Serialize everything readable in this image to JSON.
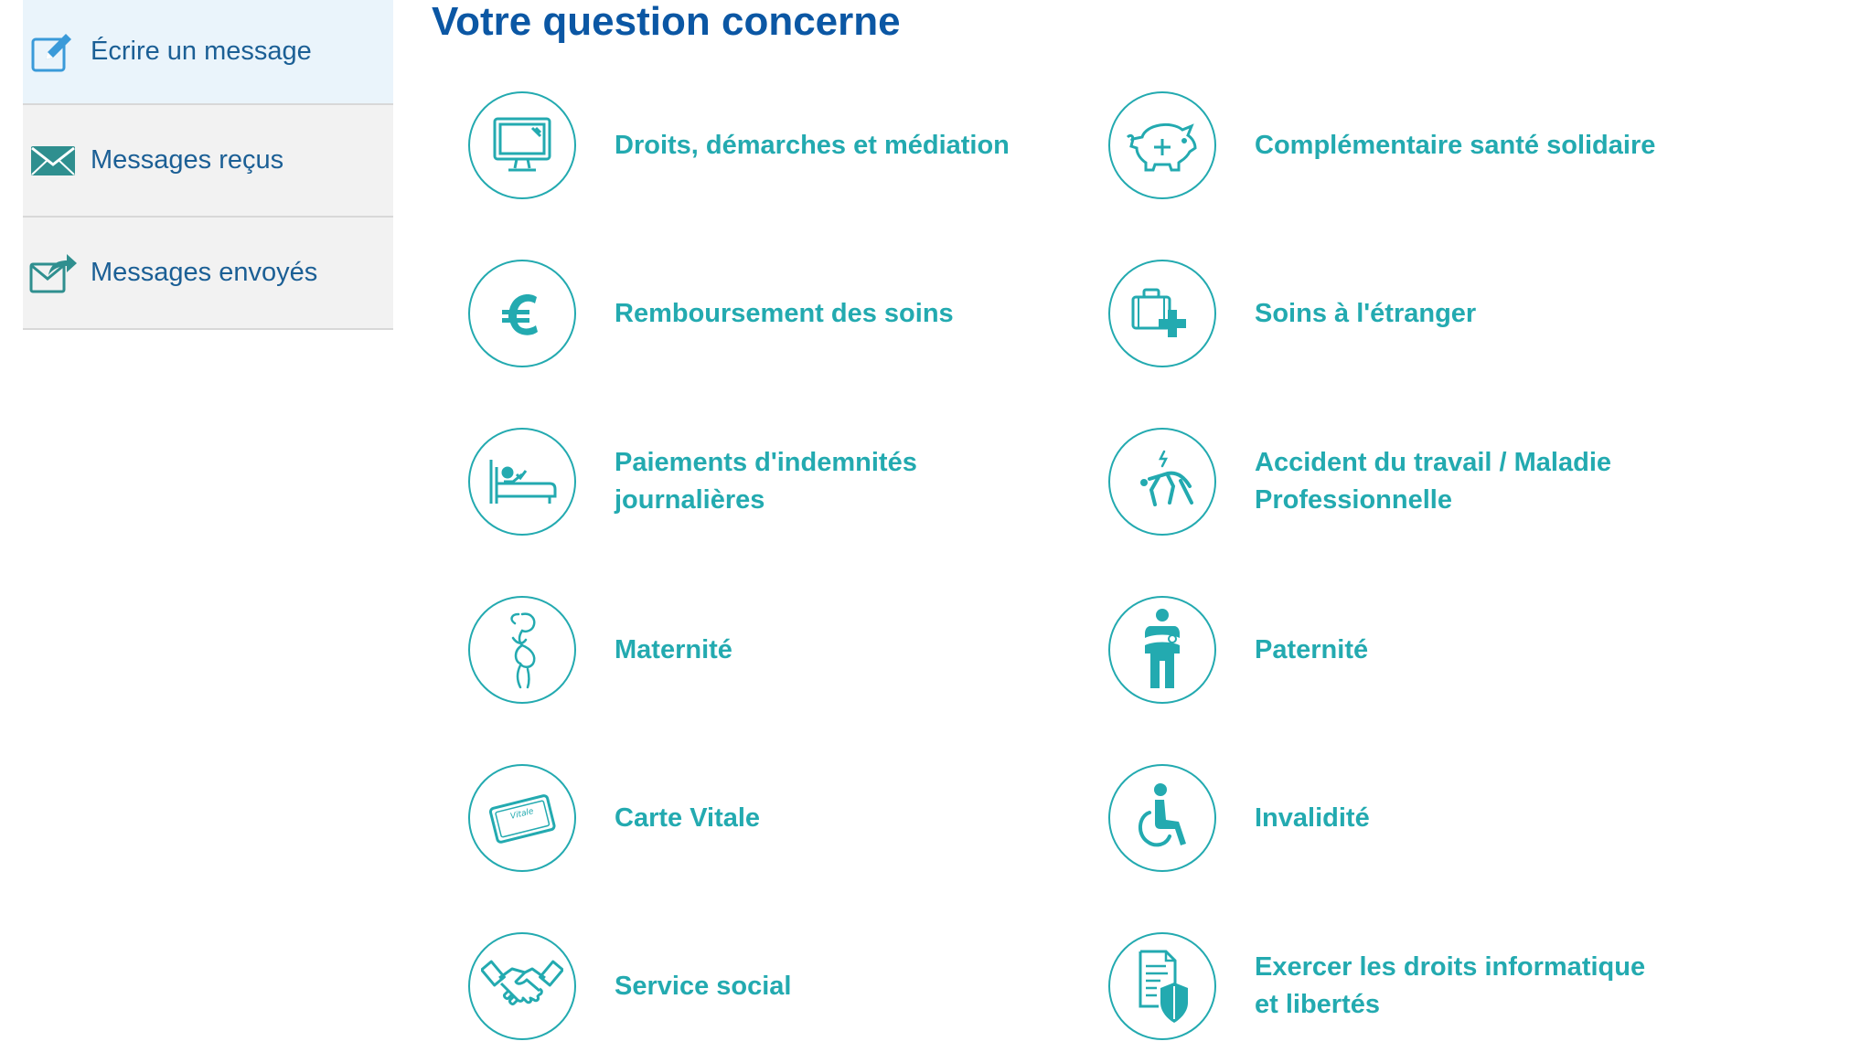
{
  "sidebar": {
    "items": [
      {
        "label": "Écrire un message",
        "icon": "pencil-edit-icon",
        "active": true
      },
      {
        "label": "Messages reçus",
        "icon": "envelope-icon",
        "active": false
      },
      {
        "label": "Messages envoyés",
        "icon": "send-message-icon",
        "active": false
      }
    ]
  },
  "main": {
    "title": "Votre question concerne",
    "topics": [
      {
        "label": "Droits, démarches et médiation",
        "icon": "computer-monitor-icon"
      },
      {
        "label": "Complémentaire santé solidaire",
        "icon": "piggy-bank-plus-icon"
      },
      {
        "label": "Remboursement des soins",
        "icon": "euro-icon"
      },
      {
        "label": "Soins à l'étranger",
        "icon": "suitcase-medical-icon"
      },
      {
        "label": "Paiements d'indemnités journalières",
        "icon": "hospital-bed-icon"
      },
      {
        "label": "Accident du travail / Maladie Professionnelle",
        "icon": "falling-person-icon"
      },
      {
        "label": "Maternité",
        "icon": "pregnant-woman-icon"
      },
      {
        "label": "Paternité",
        "icon": "father-baby-icon"
      },
      {
        "label": "Carte Vitale",
        "icon": "vitale-card-icon"
      },
      {
        "label": "Invalidité",
        "icon": "wheelchair-icon"
      },
      {
        "label": "Service social",
        "icon": "handshake-icon"
      },
      {
        "label": "Exercer les droits informatique et libertés",
        "icon": "document-shield-icon"
      }
    ]
  },
  "colors": {
    "accent": "#23aab0",
    "title": "#0b57a4",
    "sidebar_text": "#1b5f95",
    "sidebar_bg": "#f2f2f2",
    "sidebar_active_bg": "#eaf4fb"
  }
}
